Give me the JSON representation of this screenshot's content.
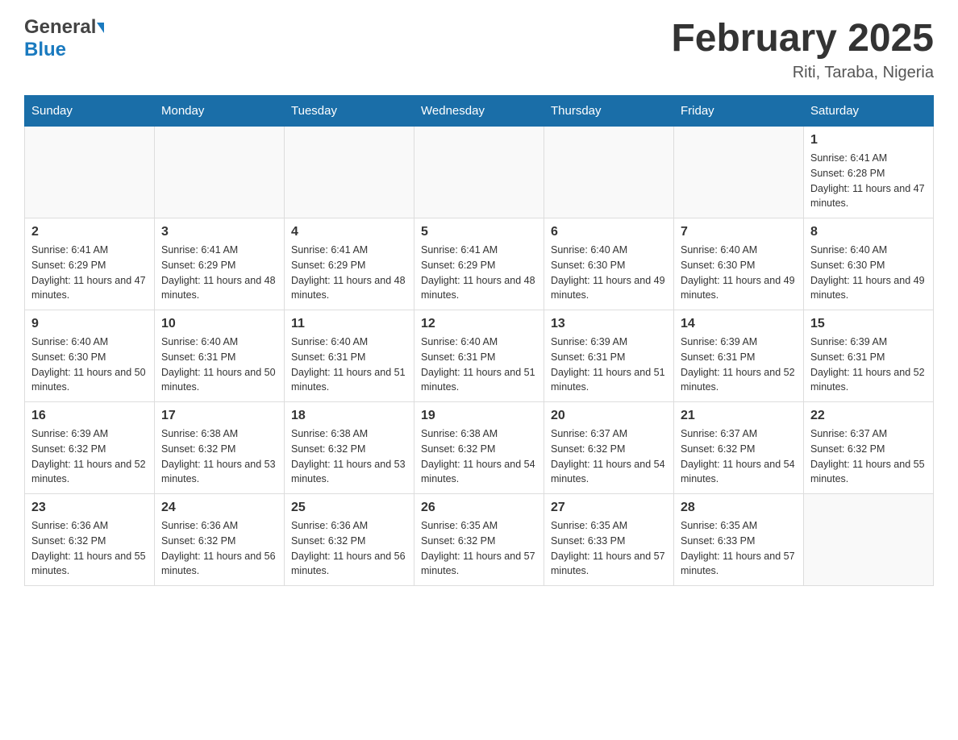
{
  "header": {
    "title": "February 2025",
    "subtitle": "Riti, Taraba, Nigeria",
    "logo_general": "General",
    "logo_blue": "Blue"
  },
  "calendar": {
    "days_of_week": [
      "Sunday",
      "Monday",
      "Tuesday",
      "Wednesday",
      "Thursday",
      "Friday",
      "Saturday"
    ],
    "weeks": [
      {
        "days": [
          {
            "num": "",
            "info": ""
          },
          {
            "num": "",
            "info": ""
          },
          {
            "num": "",
            "info": ""
          },
          {
            "num": "",
            "info": ""
          },
          {
            "num": "",
            "info": ""
          },
          {
            "num": "",
            "info": ""
          },
          {
            "num": "1",
            "info": "Sunrise: 6:41 AM\nSunset: 6:28 PM\nDaylight: 11 hours and 47 minutes."
          }
        ]
      },
      {
        "days": [
          {
            "num": "2",
            "info": "Sunrise: 6:41 AM\nSunset: 6:29 PM\nDaylight: 11 hours and 47 minutes."
          },
          {
            "num": "3",
            "info": "Sunrise: 6:41 AM\nSunset: 6:29 PM\nDaylight: 11 hours and 48 minutes."
          },
          {
            "num": "4",
            "info": "Sunrise: 6:41 AM\nSunset: 6:29 PM\nDaylight: 11 hours and 48 minutes."
          },
          {
            "num": "5",
            "info": "Sunrise: 6:41 AM\nSunset: 6:29 PM\nDaylight: 11 hours and 48 minutes."
          },
          {
            "num": "6",
            "info": "Sunrise: 6:40 AM\nSunset: 6:30 PM\nDaylight: 11 hours and 49 minutes."
          },
          {
            "num": "7",
            "info": "Sunrise: 6:40 AM\nSunset: 6:30 PM\nDaylight: 11 hours and 49 minutes."
          },
          {
            "num": "8",
            "info": "Sunrise: 6:40 AM\nSunset: 6:30 PM\nDaylight: 11 hours and 49 minutes."
          }
        ]
      },
      {
        "days": [
          {
            "num": "9",
            "info": "Sunrise: 6:40 AM\nSunset: 6:30 PM\nDaylight: 11 hours and 50 minutes."
          },
          {
            "num": "10",
            "info": "Sunrise: 6:40 AM\nSunset: 6:31 PM\nDaylight: 11 hours and 50 minutes."
          },
          {
            "num": "11",
            "info": "Sunrise: 6:40 AM\nSunset: 6:31 PM\nDaylight: 11 hours and 51 minutes."
          },
          {
            "num": "12",
            "info": "Sunrise: 6:40 AM\nSunset: 6:31 PM\nDaylight: 11 hours and 51 minutes."
          },
          {
            "num": "13",
            "info": "Sunrise: 6:39 AM\nSunset: 6:31 PM\nDaylight: 11 hours and 51 minutes."
          },
          {
            "num": "14",
            "info": "Sunrise: 6:39 AM\nSunset: 6:31 PM\nDaylight: 11 hours and 52 minutes."
          },
          {
            "num": "15",
            "info": "Sunrise: 6:39 AM\nSunset: 6:31 PM\nDaylight: 11 hours and 52 minutes."
          }
        ]
      },
      {
        "days": [
          {
            "num": "16",
            "info": "Sunrise: 6:39 AM\nSunset: 6:32 PM\nDaylight: 11 hours and 52 minutes."
          },
          {
            "num": "17",
            "info": "Sunrise: 6:38 AM\nSunset: 6:32 PM\nDaylight: 11 hours and 53 minutes."
          },
          {
            "num": "18",
            "info": "Sunrise: 6:38 AM\nSunset: 6:32 PM\nDaylight: 11 hours and 53 minutes."
          },
          {
            "num": "19",
            "info": "Sunrise: 6:38 AM\nSunset: 6:32 PM\nDaylight: 11 hours and 54 minutes."
          },
          {
            "num": "20",
            "info": "Sunrise: 6:37 AM\nSunset: 6:32 PM\nDaylight: 11 hours and 54 minutes."
          },
          {
            "num": "21",
            "info": "Sunrise: 6:37 AM\nSunset: 6:32 PM\nDaylight: 11 hours and 54 minutes."
          },
          {
            "num": "22",
            "info": "Sunrise: 6:37 AM\nSunset: 6:32 PM\nDaylight: 11 hours and 55 minutes."
          }
        ]
      },
      {
        "days": [
          {
            "num": "23",
            "info": "Sunrise: 6:36 AM\nSunset: 6:32 PM\nDaylight: 11 hours and 55 minutes."
          },
          {
            "num": "24",
            "info": "Sunrise: 6:36 AM\nSunset: 6:32 PM\nDaylight: 11 hours and 56 minutes."
          },
          {
            "num": "25",
            "info": "Sunrise: 6:36 AM\nSunset: 6:32 PM\nDaylight: 11 hours and 56 minutes."
          },
          {
            "num": "26",
            "info": "Sunrise: 6:35 AM\nSunset: 6:32 PM\nDaylight: 11 hours and 57 minutes."
          },
          {
            "num": "27",
            "info": "Sunrise: 6:35 AM\nSunset: 6:33 PM\nDaylight: 11 hours and 57 minutes."
          },
          {
            "num": "28",
            "info": "Sunrise: 6:35 AM\nSunset: 6:33 PM\nDaylight: 11 hours and 57 minutes."
          },
          {
            "num": "",
            "info": ""
          }
        ]
      }
    ]
  }
}
